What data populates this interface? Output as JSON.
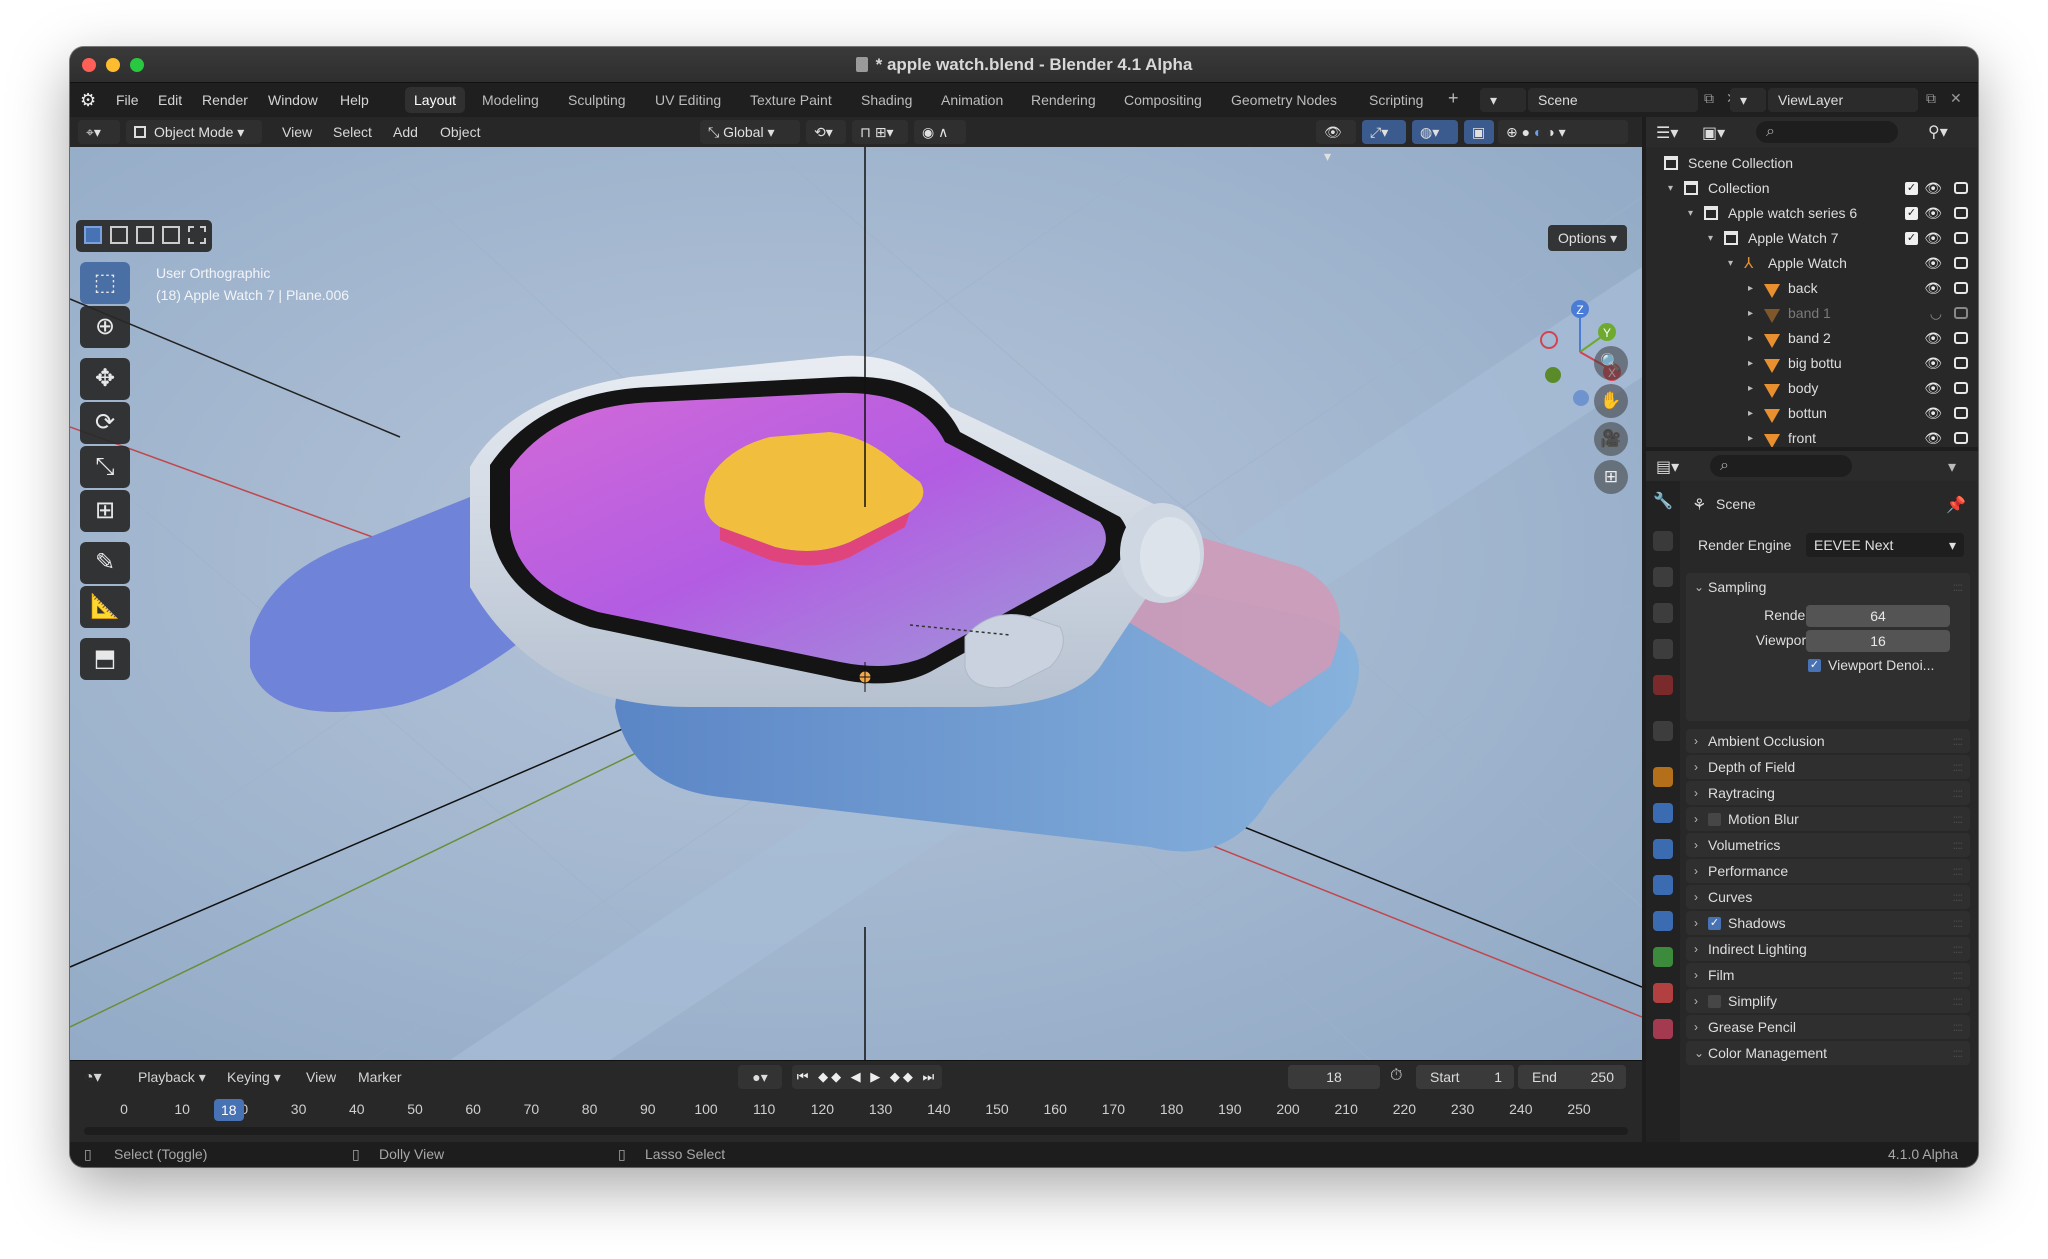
{
  "window": {
    "title": "* apple watch.blend - Blender 4.1 Alpha"
  },
  "menu": [
    "File",
    "Edit",
    "Render",
    "Window",
    "Help"
  ],
  "workspaces": [
    "Layout",
    "Modeling",
    "Sculpting",
    "UV Editing",
    "Texture Paint",
    "Shading",
    "Animation",
    "Rendering",
    "Compositing",
    "Geometry Nodes",
    "Scripting"
  ],
  "active_workspace": "Layout",
  "scene_field": "Scene",
  "viewlayer_field": "ViewLayer",
  "viewport": {
    "mode": "Object Mode",
    "menus": [
      "View",
      "Select",
      "Add",
      "Object"
    ],
    "orientation": "Global",
    "options": "Options",
    "info_line1": "User Orthographic",
    "info_line2": "(18) Apple Watch  7 | Plane.006",
    "gizmo_axes": {
      "z": "Z",
      "y": "Y",
      "x": "X"
    }
  },
  "timeline": {
    "menus": [
      "Playback",
      "Keying",
      "View",
      "Marker"
    ],
    "current_frame": "18",
    "start_label": "Start",
    "start": "1",
    "end_label": "End",
    "end": "250",
    "ticks": [
      "0",
      "10",
      "20",
      "30",
      "40",
      "50",
      "60",
      "70",
      "80",
      "90",
      "100",
      "110",
      "120",
      "130",
      "140",
      "150",
      "160",
      "170",
      "180",
      "190",
      "200",
      "210",
      "220",
      "230",
      "240",
      "250"
    ]
  },
  "statusbar": {
    "select": "Select (Toggle)",
    "dolly": "Dolly View",
    "lasso": "Lasso Select",
    "version": "4.1.0 Alpha"
  },
  "outliner": {
    "rows": [
      {
        "label": "Scene Collection",
        "depth": 0,
        "kind": "scene"
      },
      {
        "label": "Collection",
        "depth": 1,
        "kind": "collection",
        "check": true
      },
      {
        "label": "Apple watch series 6",
        "depth": 2,
        "kind": "collection",
        "check": true
      },
      {
        "label": "Apple Watch  7",
        "depth": 3,
        "kind": "collection",
        "check": true
      },
      {
        "label": "Apple Watch",
        "depth": 4,
        "kind": "armature"
      },
      {
        "label": "back",
        "depth": 5,
        "kind": "mesh"
      },
      {
        "label": "band 1",
        "depth": 5,
        "kind": "mesh",
        "hidden": true
      },
      {
        "label": "band 2",
        "depth": 5,
        "kind": "mesh"
      },
      {
        "label": "big bottu",
        "depth": 5,
        "kind": "mesh"
      },
      {
        "label": "body",
        "depth": 5,
        "kind": "mesh"
      },
      {
        "label": "bottun",
        "depth": 5,
        "kind": "mesh"
      },
      {
        "label": "front",
        "depth": 5,
        "kind": "mesh"
      }
    ]
  },
  "properties": {
    "scene_label": "Scene",
    "render_engine_label": "Render Engine",
    "render_engine": "EEVEE Next",
    "sampling": "Sampling",
    "render_label": "Render",
    "render_samples": "64",
    "viewport_label": "Viewport",
    "viewport_samples": "16",
    "viewport_denoise": "Viewport Denoi...",
    "panels": [
      {
        "label": "Ambient Occlusion"
      },
      {
        "label": "Depth of Field"
      },
      {
        "label": "Raytracing"
      },
      {
        "label": "Motion Blur",
        "checkbox": false
      },
      {
        "label": "Volumetrics"
      },
      {
        "label": "Performance"
      },
      {
        "label": "Curves"
      },
      {
        "label": "Shadows",
        "checkbox": true
      },
      {
        "label": "Indirect Lighting"
      },
      {
        "label": "Film"
      },
      {
        "label": "Simplify",
        "checkbox": false
      },
      {
        "label": "Grease Pencil"
      },
      {
        "label": "Color Management"
      }
    ]
  },
  "colors": {
    "accent": "#4772b3",
    "background": "#1d1d1d",
    "panel": "#282828",
    "object_icon": "#e8902f",
    "scene_floor": "#a9bdd6"
  }
}
